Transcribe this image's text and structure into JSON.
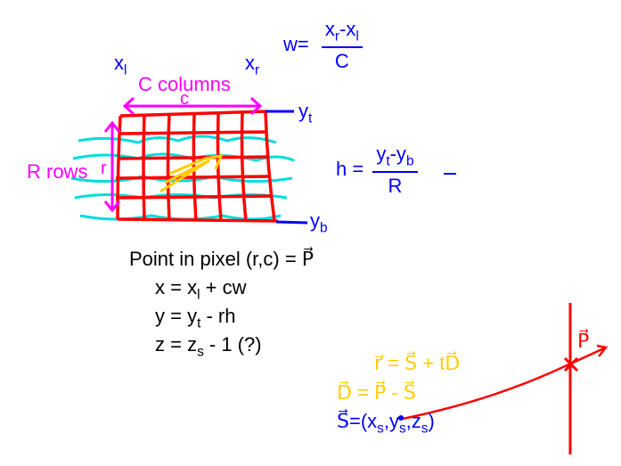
{
  "labels": {
    "xl": "x",
    "xl_sub": "l",
    "xr": "x",
    "xr_sub": "r",
    "columns": "C columns",
    "c_arrow": "c",
    "rows": "R rows",
    "r_arrow": "r",
    "yt": "y",
    "yt_sub": "t",
    "yb": "y",
    "yb_sub": "b",
    "w_eq_lhs": "w=",
    "w_num_left": "x",
    "w_num_left_sub": "r",
    "w_num_mid": "-x",
    "w_num_right_sub": "l",
    "w_den": "C",
    "h_eq_lhs": "h =",
    "h_num_left": "y",
    "h_num_left_sub": "t",
    "h_num_mid": "-y",
    "h_num_right_sub": "b",
    "h_den": "R",
    "point_line": "Point in pixel (r,c) = P⃗",
    "x_eq_a": "x = x",
    "x_eq_sub": "l",
    "x_eq_b": " + cw",
    "y_eq_a": "y = y",
    "y_eq_sub": "t",
    "y_eq_b": " - rh",
    "z_eq_a": "z = z",
    "z_eq_sub": "s",
    "z_eq_b": " - 1 (?)",
    "r_eq": "r⃗ = S⃗ + tD⃗",
    "d_eq": "D⃗ = P⃗ - S⃗",
    "s_eq_lhs": "S⃗=(x",
    "s_eq_sub1": "s",
    "s_eq_mid1": ",y",
    "s_eq_sub2": "s",
    "s_eq_mid2": ",z",
    "s_eq_sub3": "s",
    "s_eq_end": ")",
    "p_vec": "P⃗"
  }
}
